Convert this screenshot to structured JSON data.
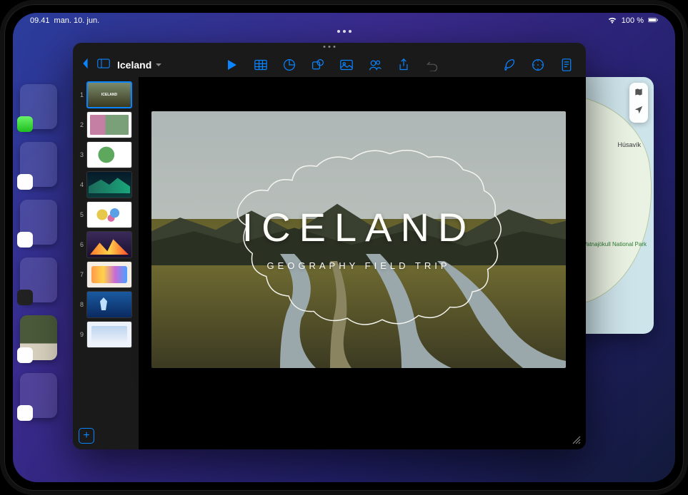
{
  "statusbar": {
    "time": "09.41",
    "date": "man. 10. jun.",
    "battery": "100 %",
    "wifi": true
  },
  "shelf": {
    "apps": [
      "messages",
      "files",
      "freeform",
      "calculator",
      "img",
      "photos"
    ]
  },
  "maps": {
    "label_city": "Húsavík",
    "label_park": "Vatnajökull National Park",
    "controls": {
      "map_mode": "map-mode-icon",
      "locate": "locate-icon"
    }
  },
  "keynote": {
    "title": "Iceland",
    "tools": {
      "back": "back-icon",
      "sidebar": "sidebar-icon",
      "play": "play-icon",
      "table": "table-icon",
      "chart": "chart-icon",
      "shape": "shape-icon",
      "media": "media-icon",
      "collab": "collab-icon",
      "share": "share-icon",
      "undo": "undo-icon",
      "format": "format-icon",
      "animate": "animate-icon",
      "document": "document-icon"
    },
    "slides": [
      1,
      2,
      3,
      4,
      5,
      6,
      7,
      8,
      9
    ],
    "selected_slide": 1,
    "add_label": "+",
    "slide1": {
      "title": "ICELAND",
      "subtitle": "GEOGRAPHY FIELD TRIP"
    }
  }
}
